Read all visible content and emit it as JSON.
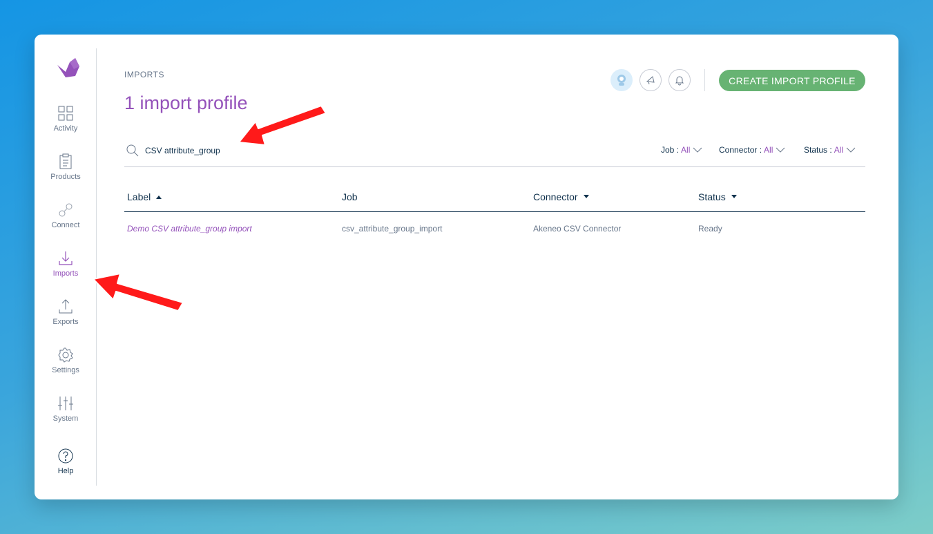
{
  "sidebar": {
    "items": [
      {
        "label": "Activity",
        "icon": "grid-icon"
      },
      {
        "label": "Products",
        "icon": "clipboard-icon"
      },
      {
        "label": "Connect",
        "icon": "link-icon"
      },
      {
        "label": "Imports",
        "icon": "import-icon",
        "active": true
      },
      {
        "label": "Exports",
        "icon": "export-icon"
      },
      {
        "label": "Settings",
        "icon": "gear-icon"
      },
      {
        "label": "System",
        "icon": "sliders-icon"
      },
      {
        "label": "Help",
        "icon": "help-icon"
      }
    ]
  },
  "header": {
    "breadcrumb": "IMPORTS",
    "title": "1 import profile",
    "create_button": "CREATE IMPORT PROFILE"
  },
  "search": {
    "value": "CSV attribute_group"
  },
  "filters": [
    {
      "label": "Job",
      "value": "All"
    },
    {
      "label": "Connector",
      "value": "All"
    },
    {
      "label": "Status",
      "value": "All"
    }
  ],
  "table": {
    "columns": [
      "Label",
      "Job",
      "Connector",
      "Status"
    ],
    "rows": [
      {
        "label": "Demo CSV attribute_group import",
        "job": "csv_attribute_group_import",
        "connector": "Akeneo CSV Connector",
        "status": "Ready"
      }
    ]
  },
  "colors": {
    "accent": "#9452ba",
    "button": "#67b373",
    "text": "#11324d",
    "muted": "#67768a",
    "annotation": "#ff0000"
  }
}
